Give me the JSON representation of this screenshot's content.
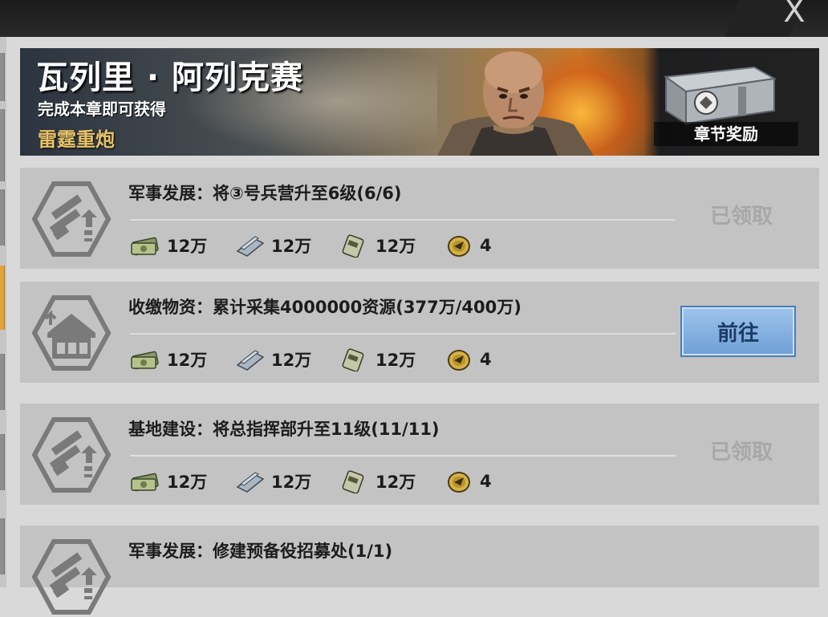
{
  "banner": {
    "title": "瓦列里 · 阿列克赛",
    "subtitle": "完成本章即可获得",
    "reward_name": "雷霆重炮",
    "chapter_reward_label": "章节奖励"
  },
  "tasks": [
    {
      "title": "军事发展：将③号兵营升至6级(6/6)",
      "icon": "military-development-icon",
      "status": "已领取",
      "rewards": [
        {
          "icon": "cash-icon",
          "amount": "12万"
        },
        {
          "icon": "steel-icon",
          "amount": "12万"
        },
        {
          "icon": "oil-icon",
          "amount": "12万"
        },
        {
          "icon": "gold-coin-icon",
          "amount": "4"
        }
      ]
    },
    {
      "title": "收缴物资：累计采集4000000资源(377万/400万)",
      "icon": "collect-resources-icon",
      "button": "前往",
      "rewards": [
        {
          "icon": "cash-icon",
          "amount": "12万"
        },
        {
          "icon": "steel-icon",
          "amount": "12万"
        },
        {
          "icon": "oil-icon",
          "amount": "12万"
        },
        {
          "icon": "gold-coin-icon",
          "amount": "4"
        }
      ]
    },
    {
      "title": "基地建设：将总指挥部升至11级(11/11)",
      "icon": "military-development-icon",
      "status": "已领取",
      "rewards": [
        {
          "icon": "cash-icon",
          "amount": "12万"
        },
        {
          "icon": "steel-icon",
          "amount": "12万"
        },
        {
          "icon": "oil-icon",
          "amount": "12万"
        },
        {
          "icon": "gold-coin-icon",
          "amount": "4"
        }
      ]
    },
    {
      "title": "军事发展：修建预备役招募处(1/1)",
      "icon": "military-development-icon"
    }
  ],
  "close_label": "X"
}
